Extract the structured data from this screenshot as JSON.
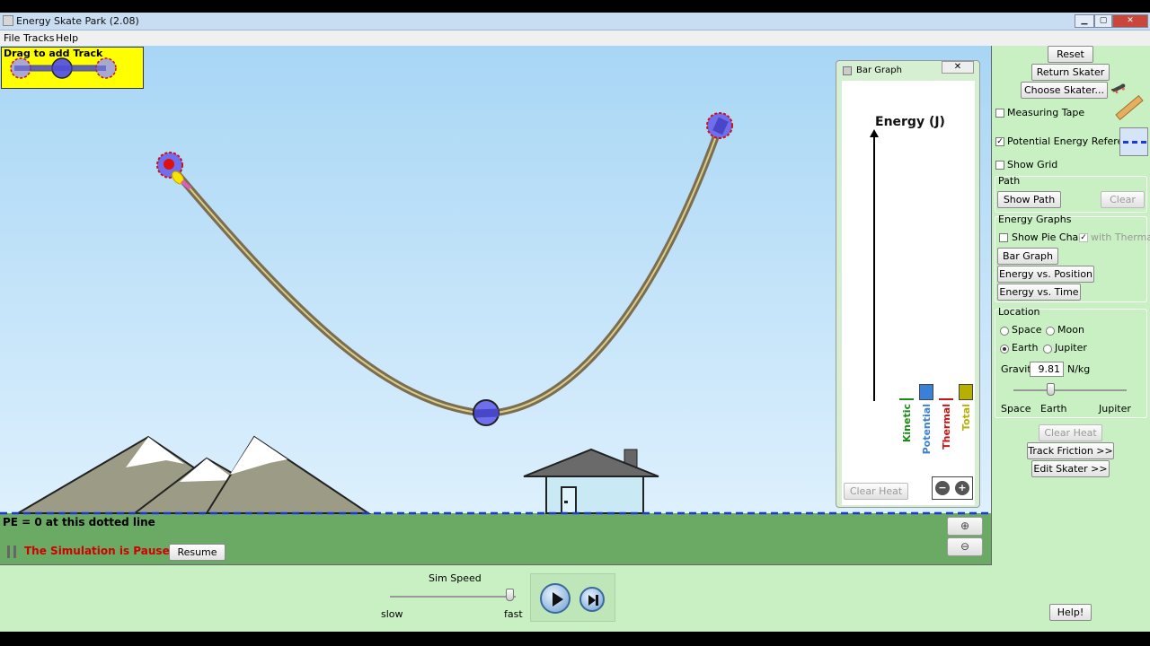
{
  "window": {
    "title": "Energy Skate Park (2.08)",
    "controls": {
      "minimize": "▁",
      "maximize": "▢",
      "close": "✕"
    }
  },
  "menu": [
    "File",
    "Tracks",
    "Help"
  ],
  "toolbox": {
    "label": "Drag to add Track"
  },
  "ground": {
    "pe_label": "PE = 0 at this dotted line",
    "paused_text": "The Simulation is Paused",
    "resume_label": "Resume"
  },
  "zoom": {
    "in_icon": "zoom-in-icon",
    "out_icon": "zoom-out-icon"
  },
  "bar_graph": {
    "window_title": "Bar Graph",
    "close": "✕",
    "heading": "Energy (J)",
    "clear_heat": "Clear Heat",
    "bars": [
      {
        "label": "Kinetic",
        "value": 0,
        "color": "#1a8c1a"
      },
      {
        "label": "Potential",
        "value": 1,
        "color": "#3a7fd8"
      },
      {
        "label": "Thermal",
        "value": 0,
        "color": "#c81414"
      },
      {
        "label": "Total",
        "value": 1,
        "color": "#b8b000"
      }
    ]
  },
  "side": {
    "reset": "Reset",
    "return_skater": "Return Skater",
    "choose_skater": "Choose Skater...",
    "measuring_tape": "Measuring Tape",
    "pe_reference": "Potential Energy Reference",
    "show_grid": "Show Grid",
    "path_title": "Path",
    "show_path": "Show Path",
    "clear": "Clear",
    "energy_graphs_title": "Energy Graphs",
    "show_pie_chart": "Show Pie Chart",
    "with_thermal": "with Thermal",
    "bar_graph": "Bar Graph",
    "energy_vs_position": "Energy vs. Position",
    "energy_vs_time": "Energy vs. Time",
    "location_title": "Location",
    "space": "Space",
    "moon": "Moon",
    "earth": "Earth",
    "jupiter": "Jupiter",
    "gravity_label": "Gravity",
    "gravity_value": "9.81",
    "gravity_unit": "N/kg",
    "gravity_scale": {
      "left": "Space",
      "mid": "Earth",
      "right": "Jupiter"
    },
    "clear_heat": "Clear Heat",
    "track_friction": "Track Friction >>",
    "edit_skater": "Edit Skater >>",
    "help": "Help!",
    "checked": {
      "measuring_tape": false,
      "pe_reference": true,
      "show_grid": false,
      "show_pie_chart": false,
      "with_thermal": true
    },
    "selected_location": "Earth"
  },
  "sim_speed": {
    "label": "Sim Speed",
    "slow": "slow",
    "fast": "fast",
    "value": 0.95
  }
}
